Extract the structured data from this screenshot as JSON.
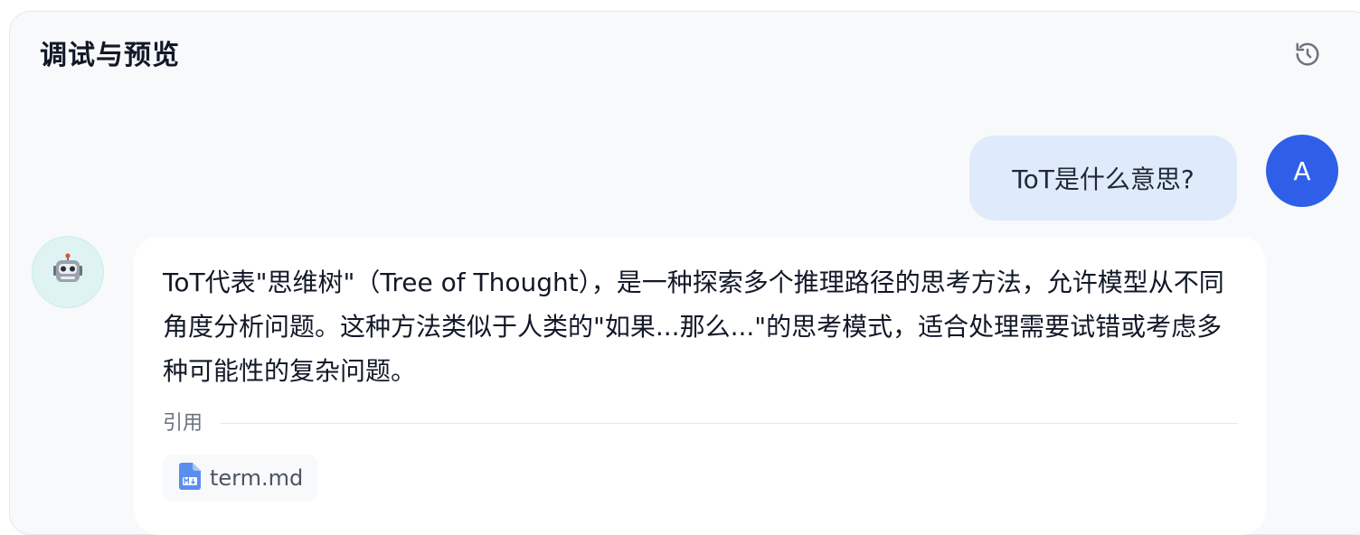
{
  "header": {
    "title": "调试与预览",
    "refresh_icon": "refresh-icon"
  },
  "conversation": {
    "user_message": {
      "text": "ToT是什么意思?",
      "avatar_letter": "A",
      "avatar_color": "#2f5fe8",
      "bubble_color": "#dfeafa"
    },
    "bot_message": {
      "avatar_icon": "robot-icon",
      "avatar_bg": "#dff3f3",
      "text": "ToT代表\"思维树\"（Tree of Thought），是一种探索多个推理路径的思考方法，允许模型从不同角度分析问题。这种方法类似于人类的\"如果...那么...\"的思考模式，适合处理需要试错或考虑多种可能性的复杂问题。",
      "citation": {
        "label": "引用",
        "files": [
          {
            "name": "term.md",
            "icon": "markdown-file-icon"
          }
        ]
      }
    }
  }
}
